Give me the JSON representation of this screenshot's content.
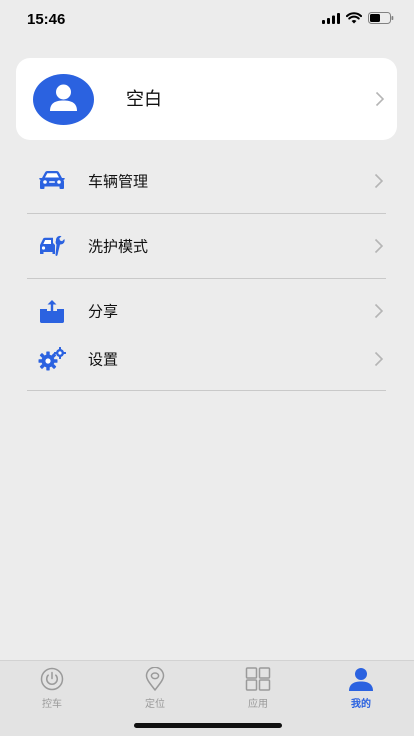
{
  "status": {
    "time": "15:46"
  },
  "profile": {
    "name": "空白"
  },
  "menu": [
    {
      "label": "车辆管理",
      "icon": "car-icon"
    },
    {
      "label": "洗护模式",
      "icon": "car-wrench-icon"
    },
    {
      "label": "分享",
      "icon": "share-icon"
    },
    {
      "label": "设置",
      "icon": "gears-icon"
    }
  ],
  "tabs": [
    {
      "label": "控车",
      "icon": "power-icon",
      "active": false
    },
    {
      "label": "定位",
      "icon": "location-pin-icon",
      "active": false
    },
    {
      "label": "应用",
      "icon": "apps-grid-icon",
      "active": false
    },
    {
      "label": "我的",
      "icon": "person-icon",
      "active": true
    }
  ],
  "colors": {
    "accent": "#2b62e0",
    "inactive": "#9a9a9a"
  }
}
